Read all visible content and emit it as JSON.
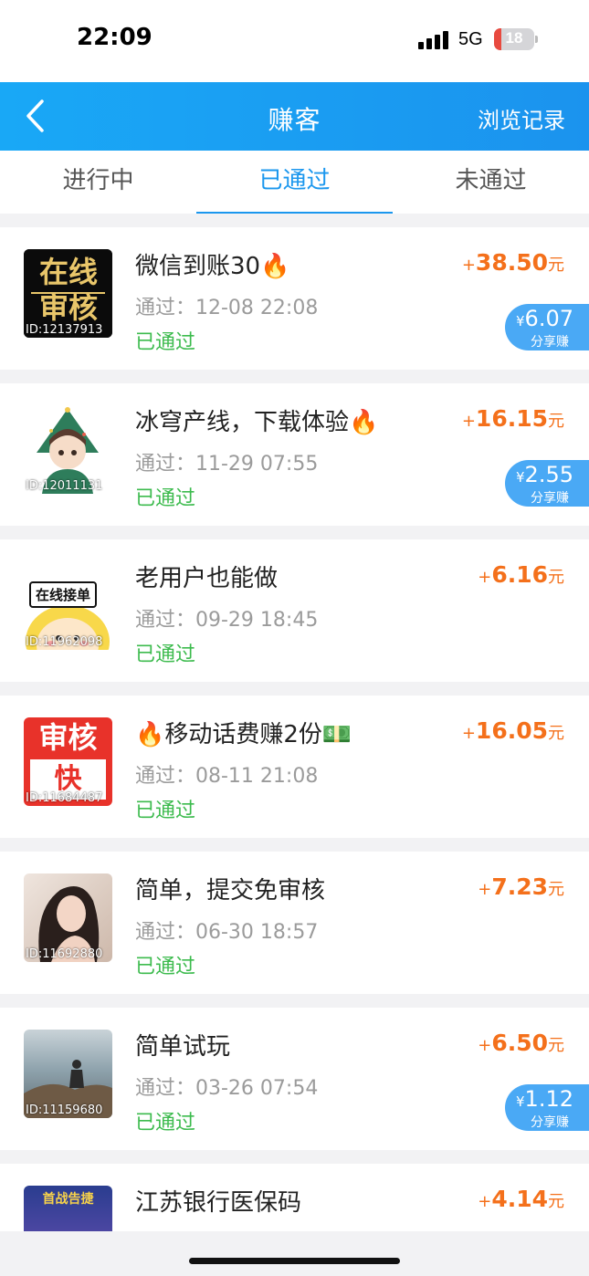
{
  "status_bar": {
    "time": "22:09",
    "network": "5G",
    "battery_level": "18"
  },
  "nav": {
    "title": "赚客",
    "history_label": "浏览记录"
  },
  "tabs": [
    {
      "label": "进行中",
      "active": false
    },
    {
      "label": "已通过",
      "active": true
    },
    {
      "label": "未通过",
      "active": false
    }
  ],
  "tasks": [
    {
      "thumb_id": "ID:12137913",
      "title": "微信到账30🔥",
      "passed_time": "通过：12-08 22:08",
      "status": "已通过",
      "reward_sign": "+",
      "reward": "38.50",
      "reward_unit": "元",
      "share_currency": "¥",
      "share_amount": "6.07",
      "share_label": "分享赚",
      "thumb_text": "在线审核"
    },
    {
      "thumb_id": "ID:12011131",
      "title": "冰穹产线，下载体验🔥",
      "passed_time": "通过：11-29 07:55",
      "status": "已通过",
      "reward_sign": "+",
      "reward": "16.15",
      "reward_unit": "元",
      "share_currency": "¥",
      "share_amount": "2.55",
      "share_label": "分享赚"
    },
    {
      "thumb_id": "ID:11962098",
      "title": "老用户也能做",
      "passed_time": "通过：09-29 18:45",
      "status": "已通过",
      "reward_sign": "+",
      "reward": "6.16",
      "reward_unit": "元",
      "thumb_text": "在线接单"
    },
    {
      "thumb_id": "ID:11684487",
      "title": "🔥移动话费赚2份💵",
      "passed_time": "通过：08-11 21:08",
      "status": "已通过",
      "reward_sign": "+",
      "reward": "16.05",
      "reward_unit": "元",
      "thumb_text_top": "审核",
      "thumb_text_bottom": "快"
    },
    {
      "thumb_id": "ID:11692880",
      "title": "简单，提交免审核",
      "passed_time": "通过：06-30 18:57",
      "status": "已通过",
      "reward_sign": "+",
      "reward": "7.23",
      "reward_unit": "元"
    },
    {
      "thumb_id": "ID:11159680",
      "title": "简单试玩",
      "passed_time": "通过：03-26 07:54",
      "status": "已通过",
      "reward_sign": "+",
      "reward": "6.50",
      "reward_unit": "元",
      "share_currency": "¥",
      "share_amount": "1.12",
      "share_label": "分享赚"
    },
    {
      "title": "江苏银行医保码",
      "reward_sign": "+",
      "reward": "4.14",
      "reward_unit": "元",
      "thumb_text": "首战告捷"
    }
  ],
  "colors": {
    "nav_blue": "#1b97ee",
    "reward_orange": "#f4701b",
    "status_green": "#3dbb4e",
    "share_blue": "#4aa9f5"
  }
}
